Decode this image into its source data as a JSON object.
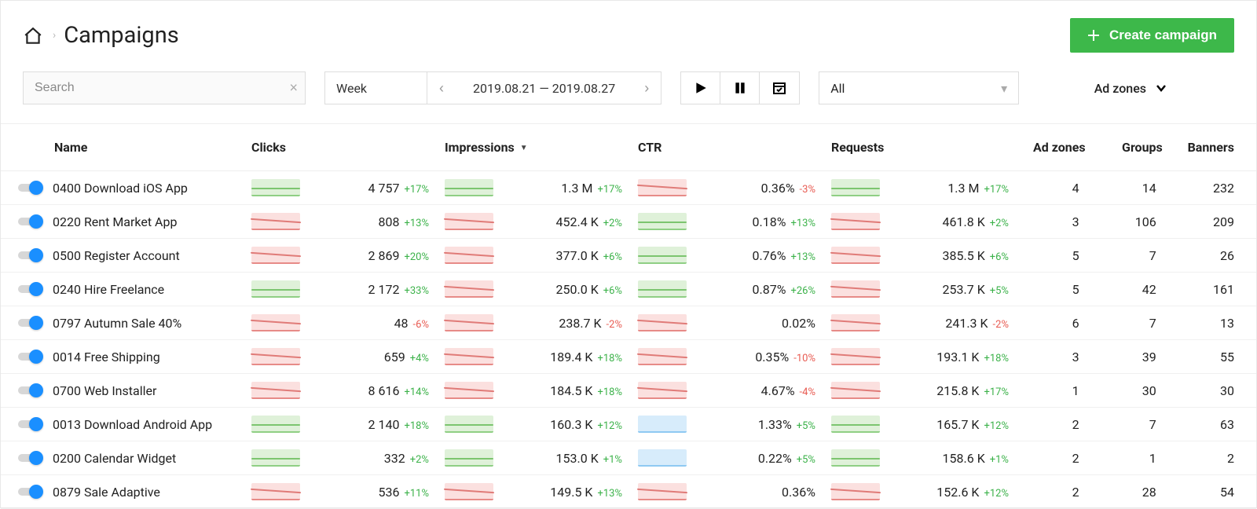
{
  "header": {
    "title": "Campaigns",
    "create_label": "Create campaign"
  },
  "toolbar": {
    "search_placeholder": "Search",
    "period_label": "Week",
    "date_range": "2019.08.21 — 2019.08.27",
    "filter_value": "All",
    "adzones_label": "Ad zones"
  },
  "columns": {
    "name": "Name",
    "clicks": "Clicks",
    "impressions": "Impressions",
    "ctr": "CTR",
    "requests": "Requests",
    "adzones": "Ad zones",
    "groups": "Groups",
    "banners": "Banners"
  },
  "rows": [
    {
      "name": "0400 Download iOS App",
      "clicks": {
        "spark": "green",
        "value": "4 757",
        "delta": "+17%",
        "dir": "pos"
      },
      "impr": {
        "spark": "green",
        "value": "1.3 M",
        "delta": "+17%",
        "dir": "pos"
      },
      "ctr": {
        "spark": "red",
        "value": "0.36%",
        "delta": "-3%",
        "dir": "neg"
      },
      "req": {
        "spark": "green",
        "value": "1.3 M",
        "delta": "+17%",
        "dir": "pos"
      },
      "az": "4",
      "gr": "14",
      "bn": "232"
    },
    {
      "name": "0220 Rent Market App",
      "clicks": {
        "spark": "red",
        "value": "808",
        "delta": "+13%",
        "dir": "pos"
      },
      "impr": {
        "spark": "red",
        "value": "452.4 K",
        "delta": "+2%",
        "dir": "pos"
      },
      "ctr": {
        "spark": "green",
        "value": "0.18%",
        "delta": "+13%",
        "dir": "pos"
      },
      "req": {
        "spark": "red",
        "value": "461.8 K",
        "delta": "+2%",
        "dir": "pos"
      },
      "az": "3",
      "gr": "106",
      "bn": "209"
    },
    {
      "name": "0500 Register Account",
      "clicks": {
        "spark": "red",
        "value": "2 869",
        "delta": "+20%",
        "dir": "pos"
      },
      "impr": {
        "spark": "red",
        "value": "377.0 K",
        "delta": "+6%",
        "dir": "pos"
      },
      "ctr": {
        "spark": "green",
        "value": "0.76%",
        "delta": "+13%",
        "dir": "pos"
      },
      "req": {
        "spark": "red",
        "value": "385.5 K",
        "delta": "+6%",
        "dir": "pos"
      },
      "az": "5",
      "gr": "7",
      "bn": "26"
    },
    {
      "name": "0240 Hire Freelance",
      "clicks": {
        "spark": "green",
        "value": "2 172",
        "delta": "+33%",
        "dir": "pos"
      },
      "impr": {
        "spark": "red",
        "value": "250.0 K",
        "delta": "+6%",
        "dir": "pos"
      },
      "ctr": {
        "spark": "green",
        "value": "0.87%",
        "delta": "+26%",
        "dir": "pos"
      },
      "req": {
        "spark": "red",
        "value": "253.7 K",
        "delta": "+5%",
        "dir": "pos"
      },
      "az": "5",
      "gr": "42",
      "bn": "161"
    },
    {
      "name": "0797 Autumn Sale 40%",
      "clicks": {
        "spark": "red",
        "value": "48",
        "delta": "-6%",
        "dir": "neg"
      },
      "impr": {
        "spark": "red",
        "value": "238.7 K",
        "delta": "-2%",
        "dir": "neg"
      },
      "ctr": {
        "spark": "red",
        "value": "0.02%",
        "delta": "",
        "dir": ""
      },
      "req": {
        "spark": "red",
        "value": "241.3 K",
        "delta": "-2%",
        "dir": "neg"
      },
      "az": "6",
      "gr": "7",
      "bn": "13"
    },
    {
      "name": "0014 Free Shipping",
      "clicks": {
        "spark": "red",
        "value": "659",
        "delta": "+4%",
        "dir": "pos"
      },
      "impr": {
        "spark": "red",
        "value": "189.4 K",
        "delta": "+18%",
        "dir": "pos"
      },
      "ctr": {
        "spark": "red",
        "value": "0.35%",
        "delta": "-10%",
        "dir": "neg"
      },
      "req": {
        "spark": "red",
        "value": "193.1 K",
        "delta": "+18%",
        "dir": "pos"
      },
      "az": "3",
      "gr": "39",
      "bn": "55"
    },
    {
      "name": "0700 Web Installer",
      "clicks": {
        "spark": "red",
        "value": "8 616",
        "delta": "+14%",
        "dir": "pos"
      },
      "impr": {
        "spark": "red",
        "value": "184.5 K",
        "delta": "+18%",
        "dir": "pos"
      },
      "ctr": {
        "spark": "red",
        "value": "4.67%",
        "delta": "-4%",
        "dir": "neg"
      },
      "req": {
        "spark": "red",
        "value": "215.8 K",
        "delta": "+17%",
        "dir": "pos"
      },
      "az": "1",
      "gr": "30",
      "bn": "30"
    },
    {
      "name": "0013 Download Android App",
      "clicks": {
        "spark": "green",
        "value": "2 140",
        "delta": "+18%",
        "dir": "pos"
      },
      "impr": {
        "spark": "green",
        "value": "160.3 K",
        "delta": "+12%",
        "dir": "pos"
      },
      "ctr": {
        "spark": "blue",
        "value": "1.33%",
        "delta": "+5%",
        "dir": "pos"
      },
      "req": {
        "spark": "green",
        "value": "165.7 K",
        "delta": "+12%",
        "dir": "pos"
      },
      "az": "2",
      "gr": "7",
      "bn": "63"
    },
    {
      "name": "0200 Calendar Widget",
      "clicks": {
        "spark": "green",
        "value": "332",
        "delta": "+2%",
        "dir": "pos"
      },
      "impr": {
        "spark": "green",
        "value": "153.0 K",
        "delta": "+1%",
        "dir": "pos"
      },
      "ctr": {
        "spark": "blue",
        "value": "0.22%",
        "delta": "+5%",
        "dir": "pos"
      },
      "req": {
        "spark": "green",
        "value": "158.6 K",
        "delta": "+1%",
        "dir": "pos"
      },
      "az": "2",
      "gr": "1",
      "bn": "2"
    },
    {
      "name": "0879 Sale Adaptive",
      "clicks": {
        "spark": "red",
        "value": "536",
        "delta": "+11%",
        "dir": "pos"
      },
      "impr": {
        "spark": "red",
        "value": "149.5 K",
        "delta": "+13%",
        "dir": "pos"
      },
      "ctr": {
        "spark": "red",
        "value": "0.36%",
        "delta": "",
        "dir": ""
      },
      "req": {
        "spark": "red",
        "value": "152.6 K",
        "delta": "+12%",
        "dir": "pos"
      },
      "az": "2",
      "gr": "28",
      "bn": "54"
    }
  ]
}
